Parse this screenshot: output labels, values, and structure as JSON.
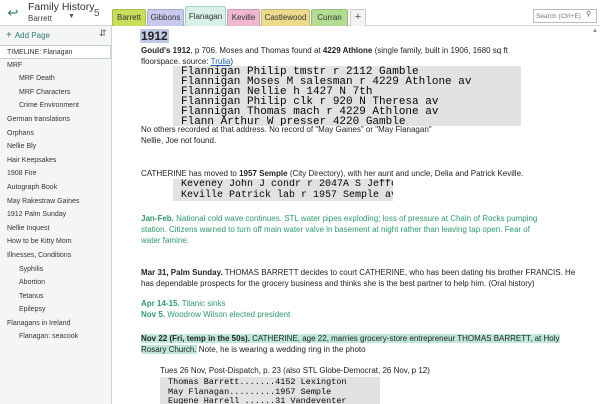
{
  "header": {
    "notebook_title": "Family History",
    "section_name": "Barrett",
    "count": "5",
    "search_placeholder": "Search (Ctrl+E)",
    "tabs": [
      {
        "label": "Barrett",
        "color": "#c8dd5a"
      },
      {
        "label": "Gibbons",
        "color": "#c7c9ef"
      },
      {
        "label": "Flanagan",
        "color": "#d8f0e8",
        "active": true
      },
      {
        "label": "Keville",
        "color": "#f0b8cf"
      },
      {
        "label": "Castlewood",
        "color": "#ecd98c"
      },
      {
        "label": "Curran",
        "color": "#b2dc92"
      }
    ],
    "add_tab": "+"
  },
  "sidebar": {
    "add_page_label": "Add Page",
    "pages": [
      {
        "label": "TIMELINE: Flanagan",
        "level": 0,
        "selected": true
      },
      {
        "label": "MRF",
        "level": 0
      },
      {
        "label": "MRF Death",
        "level": 1
      },
      {
        "label": "MRF Characters",
        "level": 1
      },
      {
        "label": "Crime Environment",
        "level": 1
      },
      {
        "label": "German translations",
        "level": 0
      },
      {
        "label": "Orphans",
        "level": 0
      },
      {
        "label": "Nellie Bly",
        "level": 0
      },
      {
        "label": "Hair Keepsakes",
        "level": 0
      },
      {
        "label": "1908 Fire",
        "level": 0
      },
      {
        "label": "Autograph Book",
        "level": 0
      },
      {
        "label": "May Rakestraw Gaines",
        "level": 0
      },
      {
        "label": "1912 Palm Sunday",
        "level": 0
      },
      {
        "label": "Nellie Inquest",
        "level": 0
      },
      {
        "label": "How to be Kitty Mom",
        "level": 0
      },
      {
        "label": "Illnesses, Conditions",
        "level": 0
      },
      {
        "label": "Syphilis",
        "level": 1
      },
      {
        "label": "Abortion",
        "level": 1
      },
      {
        "label": "Tetanus",
        "level": 1
      },
      {
        "label": "Epilepsy",
        "level": 1
      },
      {
        "label": "Flanagans in Ireland",
        "level": 0
      },
      {
        "label": "Flanagan: seacook",
        "level": 1
      }
    ]
  },
  "note": {
    "year": "1912",
    "gould_bold": "Gould's 1912",
    "gould_mid": ", p 706. Moses and Thomas found at ",
    "gould_addr": "4229 Athlone",
    "gould_tail": " (single family, built in 1906, 1680 sq ft",
    "gould_line2": "floorspace. source: ",
    "gould_link": "Trulia",
    "gould_end": ")",
    "clip1": [
      "Flannigan Philip tmstr r 2112 Gamble",
      "Flannigan Moses M salesman r 4229 Athlone av",
      "Flannigan Nellie h 1427 N 7th",
      "Flannigan Philip clk r 920 N Theresa av",
      "Flannigan Thomas mach r 4229 Athlone av",
      "Flann Arthur W presser 4220 Gamble"
    ],
    "no_others": "No others recorded at that address. No record of \"May Gaines\" or \"May Flanagan\"",
    "nellie_joe": "Nellie, Joe not found.",
    "cath_a": "CATHERINE has moved to ",
    "cath_b": "1957 Semple",
    "cath_c": " (City Directory), with her aunt and uncle, Delia and Patrick Keville.",
    "clip2": [
      "Keveney John J condr r 2047A S Jeffer",
      "Keville Patrick lab r 1957 Semple av"
    ],
    "janfeb_a": "Jan-Feb.",
    "janfeb_1": " National cold wave continues. STL water pipes exploding; loss of pressure at Chain of Rocks pumping",
    "janfeb_2": "station. Citizens warned to turn off main water valve in basement at night rather than leaving tap open. Fear of",
    "janfeb_3": "water famine.",
    "mar_a": "Mar 31, Palm Sunday.",
    "mar_1": " THOMAS BARRETT decides to court CATHERINE, who has been dating his brother FRANCIS. He",
    "mar_2": "has dependable prospects for the grocery business and thinks she is the best partner to help him. (Oral history)",
    "apr_a": "Apr 14-15.",
    "apr_b": " Titanic sinks",
    "nov_a": "Nov 5.",
    "nov_b": " Woodrow Wilson elected president",
    "nov22_a": "Nov 22 (Fri, temp in the 50s).",
    "nov22_b": " CATHERINE, age 22, marries grocery-store entrepreneur THOMAS BARRETT, at Holy",
    "nov22_c": "Rosary Church.",
    "nov22_d": " Note, he is wearing a wedding ring in the photo",
    "tues": "Tues 26 Nov, Post-Dispatch, p. 23 (also STL Globe-Democrat, 26 Nov, p 12)",
    "clip3": [
      "Thomas Barrett.......4152  Lexington",
      "May Flanagan.........1957  Semple",
      "Eugene Harrell ......31  Vandeventer"
    ]
  }
}
